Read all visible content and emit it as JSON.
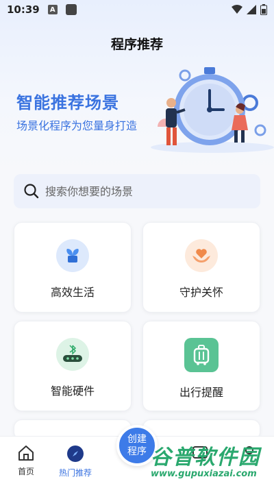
{
  "status_bar": {
    "time": "10:39",
    "app_badge": "A"
  },
  "header": {
    "title": "程序推荐"
  },
  "hero": {
    "title": "智能推荐场景",
    "subtitle": "场景化程序为您量身打造"
  },
  "search": {
    "placeholder": "搜索你想要的场景"
  },
  "cards": [
    {
      "label": "高效生活",
      "icon": "plant-icon",
      "color": "#4a8ff0"
    },
    {
      "label": "守护关怀",
      "icon": "heart-hands-icon",
      "color": "#f08a4b"
    },
    {
      "label": "智能硬件",
      "icon": "bluetooth-device-icon",
      "color": "#2eaa6a"
    },
    {
      "label": "出行提醒",
      "icon": "luggage-icon",
      "color": "#4fbf8a"
    }
  ],
  "tab_bar": {
    "home": "首页",
    "hot": "热门推荐",
    "create_line1": "创建",
    "create_line2": "程序"
  },
  "watermark": {
    "big": "谷普软件园",
    "small": "www.gupuxiazai.com"
  }
}
